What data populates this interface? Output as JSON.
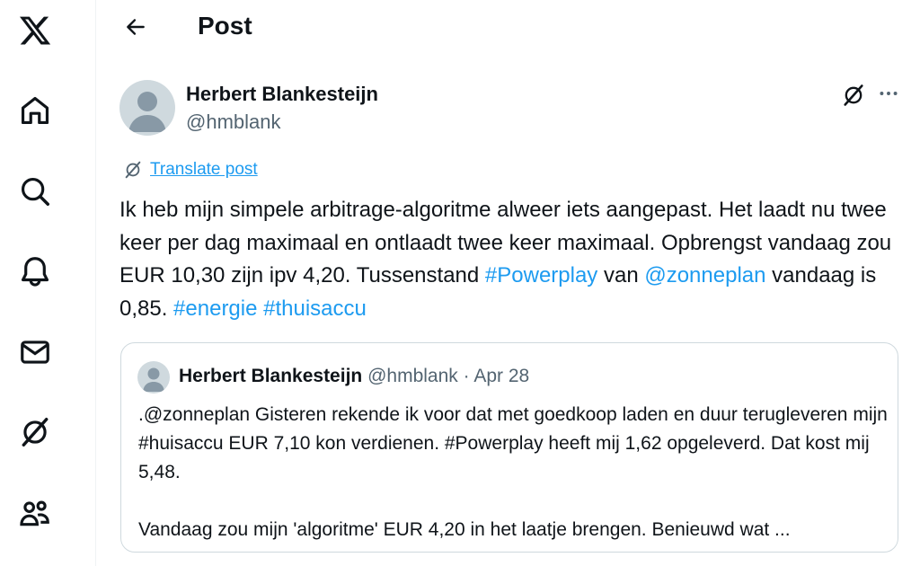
{
  "header": {
    "title": "Post"
  },
  "post": {
    "author_name": "Herbert Blankesteijn",
    "author_handle": "@hmblank",
    "translate_label": "Translate post",
    "text_line1": "Ik heb mijn simpele arbitrage-algoritme alweer iets aangepast. Het laadt nu twee keer per dag maximaal en ontlaadt twee keer maximaal. Opbrengst vandaag zou EUR 10,30 zijn  ipv 4,20. Tussenstand",
    "hashtag_powerplay": "#Powerplay",
    "text_van": " van ",
    "mention_zonneplan": "@zonneplan",
    "text_vandaag": " vandaag is 0,85. ",
    "hashtag_energie": "#energie",
    "hashtag_thuisaccu": "#thuisaccu"
  },
  "quote": {
    "author_name": "Herbert Blankesteijn",
    "author_handle": "@hmblank",
    "separator": "·",
    "date": "Apr 28",
    "paragraph1": ".@zonneplan Gisteren rekende ik voor dat met goedkoop laden en duur terugleveren mijn #huisaccu EUR 7,10 kon verdienen. #Powerplay heeft mij 1,62 opgeleverd. Dat kost mij 5,48.",
    "paragraph2": "Vandaag zou mijn 'algoritme' EUR 4,20 in het laatje brengen.  Benieuwd wat ..."
  },
  "icons": {
    "logo": "x-logo-icon",
    "home": "home-icon",
    "search": "search-icon",
    "notifications": "bell-icon",
    "messages": "mail-icon",
    "grok": "grok-icon",
    "communities": "people-icon",
    "back": "back-arrow-icon",
    "more": "more-dots-icon"
  },
  "colors": {
    "link": "#1d9bf0",
    "secondary_text": "#536471",
    "primary_text": "#0f1419",
    "border": "#cfd9de"
  }
}
